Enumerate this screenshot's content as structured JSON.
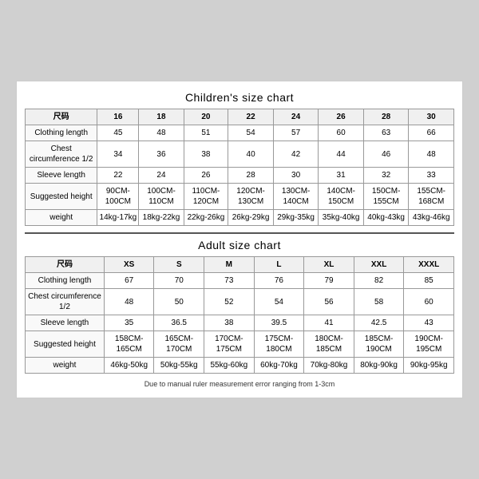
{
  "children_title": "Children's size chart",
  "adult_title": "Adult size chart",
  "note": "Due to manual ruler measurement error ranging from 1-3cm",
  "children": {
    "headers": [
      "尺码",
      "16",
      "18",
      "20",
      "22",
      "24",
      "26",
      "28",
      "30"
    ],
    "rows": [
      {
        "label": "Clothing length",
        "values": [
          "45",
          "48",
          "51",
          "54",
          "57",
          "60",
          "63",
          "66"
        ]
      },
      {
        "label": "Chest circumference 1/2",
        "values": [
          "34",
          "36",
          "38",
          "40",
          "42",
          "44",
          "46",
          "48"
        ]
      },
      {
        "label": "Sleeve length",
        "values": [
          "22",
          "24",
          "26",
          "28",
          "30",
          "31",
          "32",
          "33"
        ]
      },
      {
        "label": "Suggested height",
        "values": [
          "90CM-100CM",
          "100CM-110CM",
          "110CM-120CM",
          "120CM-130CM",
          "130CM-140CM",
          "140CM-150CM",
          "150CM-155CM",
          "155CM-168CM"
        ]
      },
      {
        "label": "weight",
        "values": [
          "14kg-17kg",
          "18kg-22kg",
          "22kg-26kg",
          "26kg-29kg",
          "29kg-35kg",
          "35kg-40kg",
          "40kg-43kg",
          "43kg-46kg"
        ]
      }
    ]
  },
  "adult": {
    "headers": [
      "尺码",
      "XS",
      "S",
      "M",
      "L",
      "XL",
      "XXL",
      "XXXL"
    ],
    "rows": [
      {
        "label": "Clothing length",
        "values": [
          "67",
          "70",
          "73",
          "76",
          "79",
          "82",
          "85"
        ]
      },
      {
        "label": "Chest circumference 1/2",
        "values": [
          "48",
          "50",
          "52",
          "54",
          "56",
          "58",
          "60"
        ]
      },
      {
        "label": "Sleeve length",
        "values": [
          "35",
          "36.5",
          "38",
          "39.5",
          "41",
          "42.5",
          "43"
        ]
      },
      {
        "label": "Suggested height",
        "values": [
          "158CM-165CM",
          "165CM-170CM",
          "170CM-175CM",
          "175CM-180CM",
          "180CM-185CM",
          "185CM-190CM",
          "190CM-195CM"
        ]
      },
      {
        "label": "weight",
        "values": [
          "46kg-50kg",
          "50kg-55kg",
          "55kg-60kg",
          "60kg-70kg",
          "70kg-80kg",
          "80kg-90kg",
          "90kg-95kg"
        ]
      }
    ]
  }
}
